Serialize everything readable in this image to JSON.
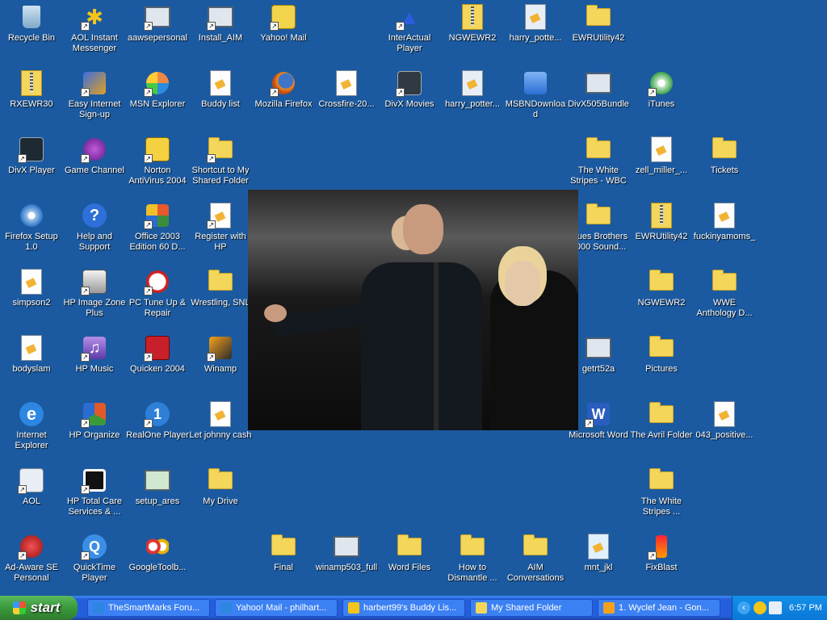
{
  "desktop_icons": [
    {
      "label": "Recycle Bin",
      "icon": "recycle-bin-icon"
    },
    {
      "label": "AOL Instant Messenger",
      "icon": "aim-running-man-icon"
    },
    {
      "label": "aawsepersonal",
      "icon": "installer-icon"
    },
    {
      "label": "Install_AIM",
      "icon": "installer-icon"
    },
    {
      "label": "Yahoo! Mail",
      "icon": "yahoo-mail-icon"
    },
    {
      "label": "InterActual Player",
      "icon": "interactual-player-icon"
    },
    {
      "label": "NGWEWR2",
      "icon": "zip-folder-icon"
    },
    {
      "label": "harry_potte...",
      "icon": "movie-file-icon"
    },
    {
      "label": "EWRUtility42",
      "icon": "folder-icon"
    },
    {
      "label": "RXEWR30",
      "icon": "zip-folder-icon"
    },
    {
      "label": "Easy Internet Sign-up",
      "icon": "easy-signup-icon"
    },
    {
      "label": "MSN Explorer",
      "icon": "msn-butterfly-icon"
    },
    {
      "label": "Buddy list",
      "icon": "aim-document-icon"
    },
    {
      "label": "Mozilla Firefox",
      "icon": "firefox-icon"
    },
    {
      "label": "Crossfire-20...",
      "icon": "document-icon"
    },
    {
      "label": "DivX Movies",
      "icon": "divx-icon"
    },
    {
      "label": "harry_potter...",
      "icon": "movie-file-icon"
    },
    {
      "label": "MSBNDownload",
      "icon": "download-icon"
    },
    {
      "label": "DivX505Bundle",
      "icon": "installer-icon"
    },
    {
      "label": "iTunes",
      "icon": "itunes-icon"
    },
    {
      "label": "DivX Player",
      "icon": "divx-player-icon"
    },
    {
      "label": "Game Channel",
      "icon": "game-channel-icon"
    },
    {
      "label": "Norton AntiVirus 2004",
      "icon": "norton-icon"
    },
    {
      "label": "Shortcut to My Shared Folder",
      "icon": "folder-icon"
    },
    {
      "label": "The White Stripes - WBC",
      "icon": "folder-icon"
    },
    {
      "label": "zell_miller_...",
      "icon": "document-icon"
    },
    {
      "label": "Tickets",
      "icon": "folder-icon"
    },
    {
      "label": "Firefox Setup 1.0",
      "icon": "setup-disc-icon"
    },
    {
      "label": "Help and Support",
      "icon": "help-icon"
    },
    {
      "label": "Office 2003 Edition 60 D...",
      "icon": "office-icon"
    },
    {
      "label": "Register with HP",
      "icon": "register-icon"
    },
    {
      "label": "Blues Brothers 2000 Sound...",
      "icon": "folder-icon"
    },
    {
      "label": "EWRUtility42",
      "icon": "zip-folder-icon"
    },
    {
      "label": "fuckinyamoms_",
      "icon": "document-icon"
    },
    {
      "label": "simpson2",
      "icon": "document-icon"
    },
    {
      "label": "HP Image Zone Plus",
      "icon": "hp-image-zone-icon"
    },
    {
      "label": "PC Tune Up & Repair",
      "icon": "tune-up-gauge-icon"
    },
    {
      "label": "Wrestling, SNL",
      "icon": "folder-icon"
    },
    {
      "label": "NGWEWR2",
      "icon": "folder-icon"
    },
    {
      "label": "WWE Anthology D...",
      "icon": "folder-icon"
    },
    {
      "label": "bodyslam",
      "icon": "document-icon"
    },
    {
      "label": "HP Music",
      "icon": "hp-music-icon"
    },
    {
      "label": "Quicken 2004",
      "icon": "quicken-icon"
    },
    {
      "label": "Winamp",
      "icon": "winamp-icon"
    },
    {
      "label": "getrt52a",
      "icon": "installer-icon"
    },
    {
      "label": "Pictures",
      "icon": "folder-icon"
    },
    {
      "label": "Internet Explorer",
      "icon": "internet-explorer-icon"
    },
    {
      "label": "HP Organize",
      "icon": "hp-organize-icon"
    },
    {
      "label": "RealOne Player",
      "icon": "realone-icon"
    },
    {
      "label": "Let johnny cash",
      "icon": "word-document-icon"
    },
    {
      "label": "Microsoft Word",
      "icon": "word-icon"
    },
    {
      "label": "The Avril Folder",
      "icon": "folder-icon"
    },
    {
      "label": "043_positive...",
      "icon": "document-icon"
    },
    {
      "label": "AOL",
      "icon": "aol-icon"
    },
    {
      "label": "HP Total Care Services & ...",
      "icon": "hp-total-care-icon"
    },
    {
      "label": "setup_ares",
      "icon": "setup-icon"
    },
    {
      "label": "My Drive",
      "icon": "folder-icon"
    },
    {
      "label": "The White Stripes ...",
      "icon": "folder-icon"
    },
    {
      "label": "Ad-Aware SE Personal",
      "icon": "ad-aware-icon"
    },
    {
      "label": "QuickTime Player",
      "icon": "quicktime-icon"
    },
    {
      "label": "GoogleToolb...",
      "icon": "google-toolbar-icon"
    },
    {
      "label": "Final",
      "icon": "folder-icon"
    },
    {
      "label": "winamp503_full",
      "icon": "installer-icon"
    },
    {
      "label": "Word Files",
      "icon": "folder-icon"
    },
    {
      "label": "How to Dismantle ...",
      "icon": "folder-icon"
    },
    {
      "label": "AIM Conversations",
      "icon": "folder-icon"
    },
    {
      "label": "mnt_jkl",
      "icon": "realone-document-icon"
    },
    {
      "label": "FixBlast",
      "icon": "fixblast-icon"
    }
  ],
  "wallpaper": {
    "subject": "photo",
    "background_color": "#1b5aa0"
  },
  "taskbar": {
    "start_label": "start",
    "tasks": [
      {
        "label": "TheSmartMarks Foru...",
        "icon": "internet-explorer-icon"
      },
      {
        "label": "Yahoo! Mail - philhart...",
        "icon": "internet-explorer-icon"
      },
      {
        "label": "harbert99's Buddy Lis...",
        "icon": "aim-running-man-icon"
      },
      {
        "label": "My Shared Folder",
        "icon": "folder-icon"
      },
      {
        "label": "1. Wyclef Jean - Gon...",
        "icon": "winamp-icon"
      }
    ],
    "clock": "6:57 PM"
  }
}
